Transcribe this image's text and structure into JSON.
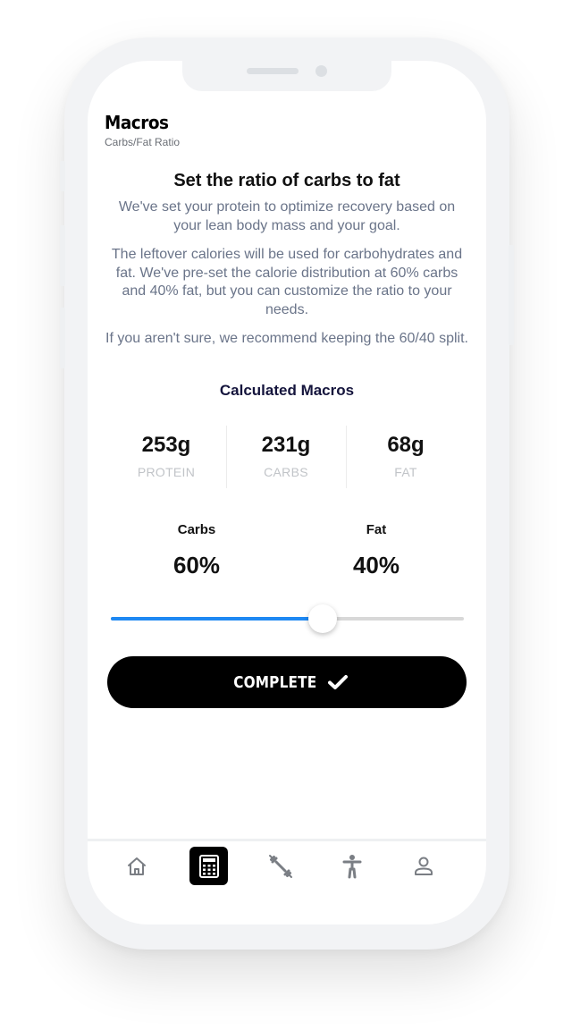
{
  "header": {
    "title": "Macros",
    "subtitle": "Carbs/Fat Ratio"
  },
  "content": {
    "heading": "Set the ratio of carbs to fat",
    "paragraph_1": "We've set your protein to optimize recovery based on your lean body mass and your goal.",
    "paragraph_2": "The leftover calories will be used for carbohydrates and fat. We've pre-set the calorie distribution at 60% carbs and 40% fat, but you can customize the ratio to your needs.",
    "paragraph_3": "If you aren't sure, we recommend keeping the 60/40 split.",
    "section_title": "Calculated Macros"
  },
  "macros": [
    {
      "value": "253g",
      "label": "PROTEIN"
    },
    {
      "value": "231g",
      "label": "CARBS"
    },
    {
      "value": "68g",
      "label": "FAT"
    }
  ],
  "ratio": {
    "carbs_label": "Carbs",
    "carbs_value": "60%",
    "fat_label": "Fat",
    "fat_value": "40%",
    "slider_fraction": 0.6
  },
  "buttons": {
    "complete_label": "COMPLETE"
  },
  "tabs": [
    {
      "icon": "home-icon"
    },
    {
      "icon": "calculator-icon"
    },
    {
      "icon": "dumbbell-icon"
    },
    {
      "icon": "body-icon"
    },
    {
      "icon": "profile-icon"
    }
  ],
  "colors": {
    "accent": "#1e88f3",
    "button": "#000000",
    "body_text": "#6a7489",
    "section_title": "#14143c"
  }
}
